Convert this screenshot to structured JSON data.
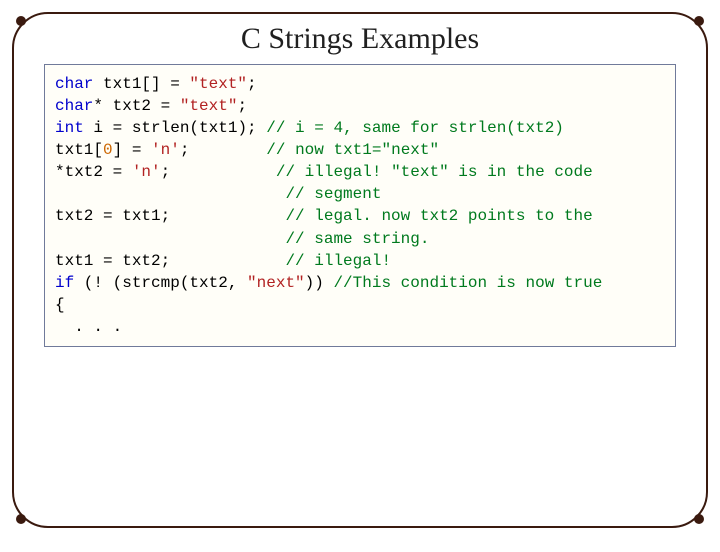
{
  "title": "C Strings Examples",
  "code": {
    "l1": {
      "kw": "char",
      "rest": " txt1[] = ",
      "str": "\"text\"",
      "tail": ";"
    },
    "l2": {
      "kw": "char",
      "rest": "* txt2 = ",
      "str": "\"text\"",
      "tail": ";"
    },
    "l3_blank": "",
    "l4": {
      "kw": "int",
      "mid": " i = strlen(txt1); ",
      "cm": "// i = 4, same for strlen(txt2)"
    },
    "l5_blank": "",
    "l6": {
      "code": "txt1[",
      "num": "0",
      "code2": "] = ",
      "str": "'n'",
      "tail": ";        ",
      "cm": "// now txt1=\"next\""
    },
    "l7": {
      "code": "*txt2 = ",
      "str": "'n'",
      "tail": ";           ",
      "cm": "// illegal! \"text\" is in the code"
    },
    "l8": {
      "pad": "                        ",
      "cm": "// segment"
    },
    "l9": {
      "code": "txt2 = txt1;            ",
      "cm": "// legal. now txt2 points to the"
    },
    "l10": {
      "pad": "                        ",
      "cm": "// same string."
    },
    "l11": {
      "code": "txt1 = txt2;            ",
      "cm": "// illegal!"
    },
    "l12_blank": "",
    "l13": {
      "kw": "if",
      "mid": " (! (strcmp(txt2, ",
      "str": "\"next\"",
      "tail": ")) ",
      "cm": "//This condition is now true"
    },
    "l14": "{",
    "l15": "  . . ."
  }
}
